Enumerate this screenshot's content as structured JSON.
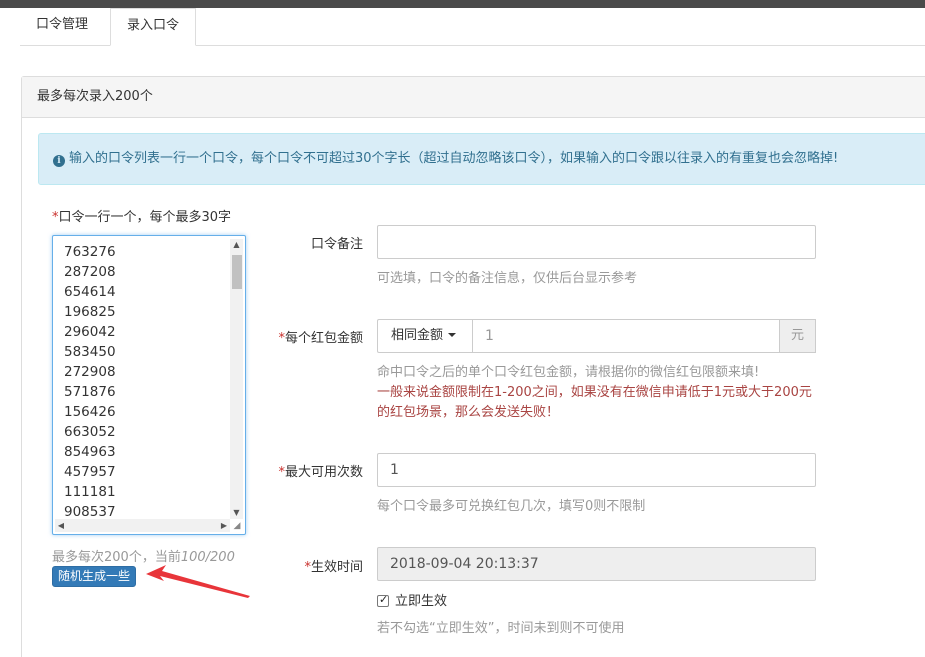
{
  "tabs": [
    {
      "label": "口令管理"
    },
    {
      "label": "录入口令"
    }
  ],
  "panel": {
    "heading": "最多每次录入200个"
  },
  "alert": {
    "icon": "info-circle-icon",
    "text": "输入的口令列表一行一个口令，每个口令不可超过30个字长（超过自动忽略该口令），如果输入的口令跟以往录入的有重复也会忽略掉!"
  },
  "codes": {
    "required_mark": "*",
    "label": "口令一行一个，每个最多30字",
    "items": [
      "763276",
      "287208",
      "654614",
      "196825",
      "296042",
      "583450",
      "272908",
      "571876",
      "156426",
      "663052",
      "854963",
      "457957",
      "111181",
      "908537"
    ],
    "help_prefix": "最多每次200个，当前",
    "help_count": "100/200",
    "generate_button": "随机生成一些"
  },
  "form": {
    "remark": {
      "label": "口令备注",
      "value": "",
      "help": "可选填，口令的备注信息，仅供后台显示参考"
    },
    "amount": {
      "required_mark": "*",
      "label": "每个红包金额",
      "mode": "相同金额",
      "value": "1",
      "unit": "元",
      "help": "命中口令之后的单个口令红包金额，请根据你的微信红包限额来填!",
      "warning": "一般来说金额限制在1-200之间，如果没有在微信申请低于1元或大于200元的红包场景，那么会发送失败！"
    },
    "max_uses": {
      "required_mark": "*",
      "label": "最大可用次数",
      "value": "1",
      "help": "每个口令最多可兑换红包几次，填写0则不限制"
    },
    "effective_time": {
      "required_mark": "*",
      "label": "生效时间",
      "value": "2018-09-04 20:13:37",
      "checkbox_label": "立即生效",
      "checked": true,
      "help": "若不勾选“立即生效”，时间未到则不可使用"
    }
  },
  "colors": {
    "primary": "#337ab7",
    "info_bg": "#d9edf7",
    "info_text": "#31708f",
    "danger": "#a94442",
    "annotation_arrow": "#e8353a"
  }
}
